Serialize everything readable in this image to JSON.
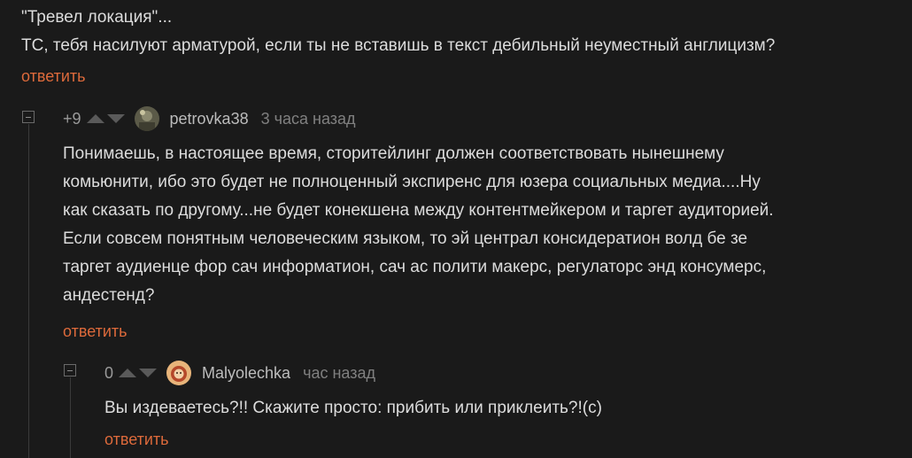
{
  "comment_top": {
    "lines": [
      "\"Тревел локация\"...",
      "ТС, тебя насилуют арматурой, если ты не вставишь в текст дебильный неуместный англицизм?"
    ],
    "reply_label": "ответить"
  },
  "comment_1": {
    "rating": "+9",
    "author": "petrovka38",
    "time": "3 часа назад",
    "lines": [
      "Понимаешь, в настоящее время, сторитейлинг должен соответствовать нынешнему",
      "комьюнити, ибо это будет не полноценный экспиренс  для юзера социальных медиа....Ну",
      "как сказать по другому...не будет конекшена между контентмейкером и таргет аудиторией.",
      "Если совсем понятным человеческим языком, то эй централ консидератион волд бе зе",
      "таргет аудиенце фор сач информатион, сач ас полити макерс, регулаторс энд консумерс,",
      "андестенд?"
    ],
    "reply_label": "ответить"
  },
  "comment_2": {
    "rating": "0",
    "author": "Malyolechka",
    "time": "час назад",
    "lines": [
      "Вы издеваетесь?!! Скажите просто: прибить или приклеить?!(с)"
    ],
    "reply_label": "ответить"
  },
  "colors": {
    "background": "#1a1a1a",
    "text": "#dcdcdc",
    "accent_link": "#dd6a3b",
    "muted": "#808080"
  },
  "icons": {
    "upvote": "arrow-up-icon",
    "downvote": "arrow-down-icon",
    "collapse": "collapse-minus-icon"
  }
}
